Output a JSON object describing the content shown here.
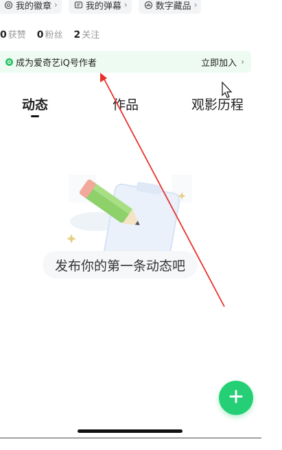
{
  "chips": [
    {
      "icon": "badge-icon",
      "label": "我的徽章"
    },
    {
      "icon": "danmaku-icon",
      "label": "我的弹幕"
    },
    {
      "icon": "collectible-icon",
      "label": "数字藏品"
    }
  ],
  "stats": [
    {
      "count": "0",
      "label": "获赞"
    },
    {
      "count": "0",
      "label": "粉丝"
    },
    {
      "count": "2",
      "label": "关注"
    }
  ],
  "creator_banner": {
    "text": "成为爱奇艺iQ号作者",
    "action": "立即加入"
  },
  "tabs": [
    {
      "label": "动态",
      "active": true
    },
    {
      "label": "作品",
      "active": false
    },
    {
      "label": "观影历程",
      "active": false
    }
  ],
  "empty_state": {
    "message": "发布你的第一条动态吧"
  },
  "colors": {
    "accent": "#25cf75",
    "banner_bg": "#eefbf2",
    "annotation": "#e8312a"
  },
  "fab": {
    "icon": "plus-icon"
  }
}
